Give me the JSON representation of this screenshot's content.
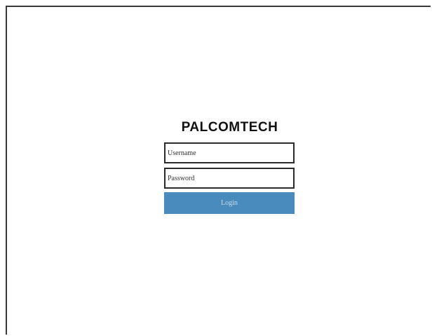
{
  "brand": {
    "title": "PALCOMTECH"
  },
  "login_form": {
    "username": {
      "value": "",
      "placeholder": "Username"
    },
    "password": {
      "value": "",
      "placeholder": "Password"
    },
    "submit_label": "Login"
  },
  "colors": {
    "background": "#ffffff",
    "frame_border": "#3a3a3a",
    "field_border": "#2b2b2b",
    "button_bg": "#4a8bbd",
    "button_text": "#c9dbe9",
    "title_text": "#111111"
  }
}
